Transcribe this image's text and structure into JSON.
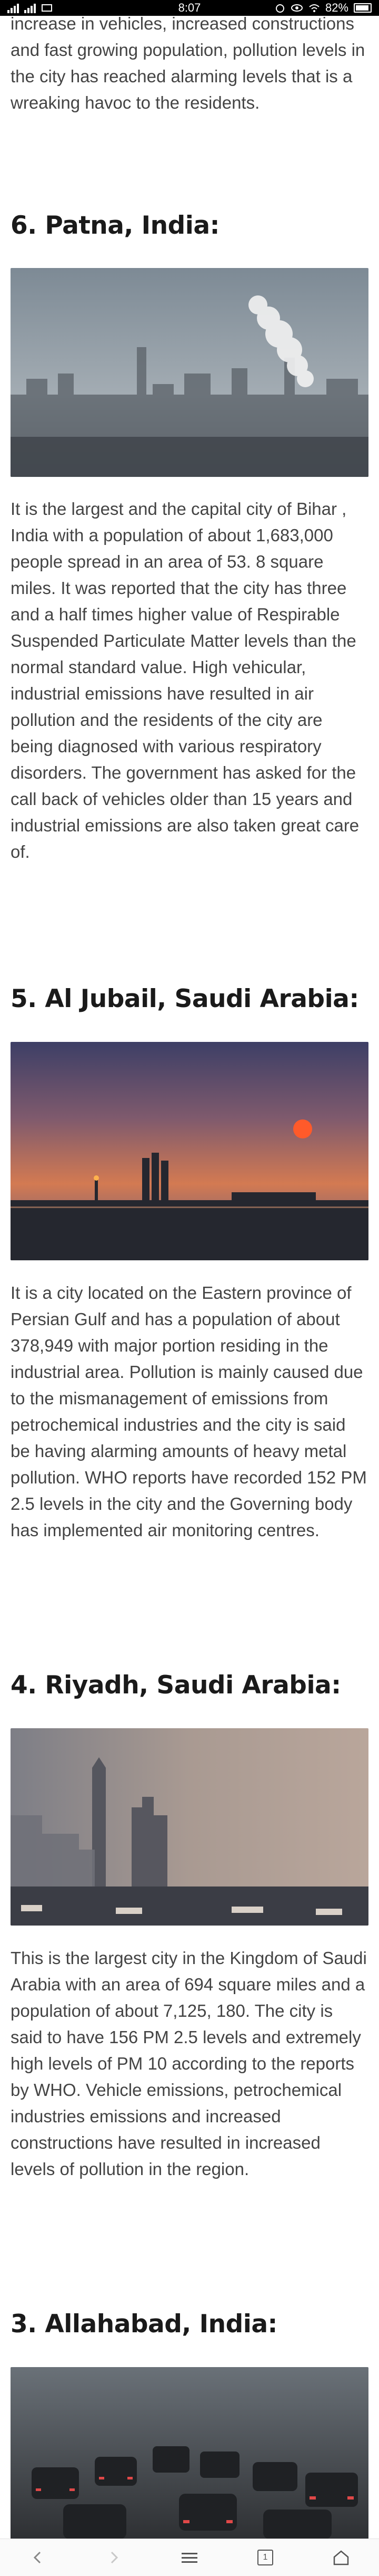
{
  "status_bar": {
    "time": "8:07",
    "battery": "82%"
  },
  "article": {
    "intro_text": "increase in vehicles, increased constructions and fast growing population, pollution levels in the city has reached alarming levels that is a wreaking havoc to the residents.",
    "sections": [
      {
        "heading": "6. Patna, India:",
        "body": "It is the largest and the capital city of Bihar , India with a population of about 1,683,000 people spread in an area of 53. 8 square miles. It was reported that the city has three and a half times higher value of Respirable Suspended Particulate Matter levels than the normal standard value. High vehicular, industrial emissions have resulted in air pollution and the residents of the city are being diagnosed with various respiratory disorders. The government has asked for the call back of vehicles older than 15 years and industrial emissions are also taken great care of."
      },
      {
        "heading": "5. Al Jubail, Saudi Arabia:",
        "body": "It is a city located on the Eastern province of Persian Gulf and has a population of about 378,949 with major portion residing in the industrial area. Pollution is mainly caused due to the mismanagement of emissions from petrochemical industries and the city is said be having alarming amounts of heavy metal pollution. WHO reports have recorded 152 PM 2.5 levels in the city and the Governing body has implemented air monitoring centres."
      },
      {
        "heading": "4. Riyadh, Saudi Arabia:",
        "body": "This is the largest city in the Kingdom of Saudi Arabia with an area of 694 square miles and a population of about 7,125, 180. The city is said to have 156 PM 2.5 levels and extremely high levels of PM 10 according to the reports by WHO. Vehicle emissions, petrochemical industries emissions and increased constructions have resulted in increased levels of pollution in the region."
      },
      {
        "heading": "3. Allahabad, India:",
        "body": ""
      }
    ]
  },
  "bottom_nav": {
    "tabs_count": "1"
  },
  "icons": {
    "back": "chevron-left-icon",
    "forward": "chevron-right-icon",
    "menu": "hamburger-menu-icon",
    "tabs": "tabs-icon",
    "home": "home-icon"
  },
  "colors": {
    "accent": "#1a1a1a",
    "text": "#444444"
  }
}
